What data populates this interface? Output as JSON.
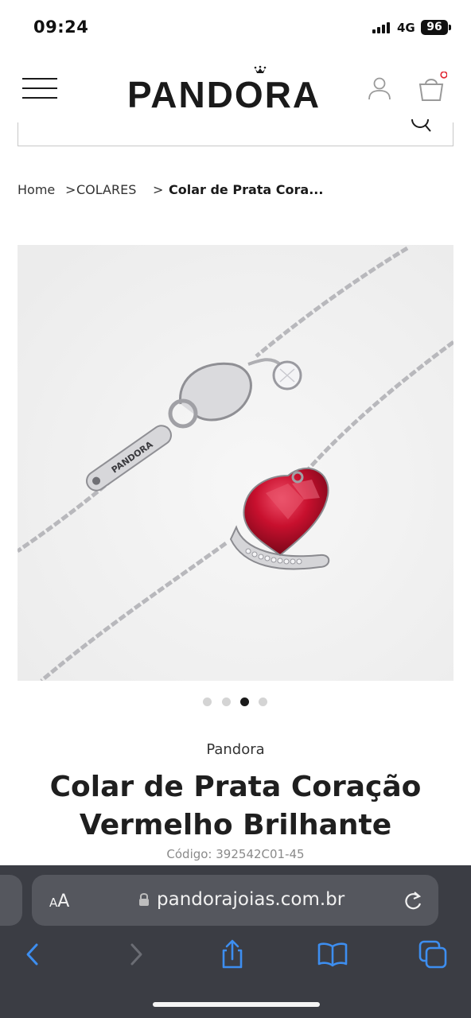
{
  "status_bar": {
    "time": "09:24",
    "network": "4G",
    "battery": "96"
  },
  "header": {
    "logo": "PANDORA",
    "menu_icon": "hamburger-menu-icon",
    "account_icon": "user-icon",
    "cart_icon": "shopping-bag-icon",
    "cart_badge_color": "#e0232f"
  },
  "search": {
    "icon": "search-icon"
  },
  "breadcrumb": {
    "home": "Home",
    "category": "COLARES",
    "current": "Colar de Prata Cora...",
    "separator": ">"
  },
  "gallery": {
    "image": "silver-chain-necklace-red-heart-pendant",
    "slide_count": 4,
    "active_slide": 3
  },
  "product": {
    "brand": "Pandora",
    "title": "Colar de Prata Coração Vermelho Brilhante",
    "code_label": "Código:",
    "code_value": "392542C01-45"
  },
  "browser": {
    "text_size_label": "AA",
    "url": "pandorajoias.com.br",
    "toolbar": [
      "back-icon",
      "forward-icon",
      "share-icon",
      "bookmarks-icon",
      "tabs-icon"
    ],
    "accent_color": "#3d8ef0"
  },
  "colors": {
    "text": "#1a1a1a",
    "muted": "#8a8a8a",
    "heart_red": "#c8102e",
    "safari_bar": "#3b3d44"
  }
}
